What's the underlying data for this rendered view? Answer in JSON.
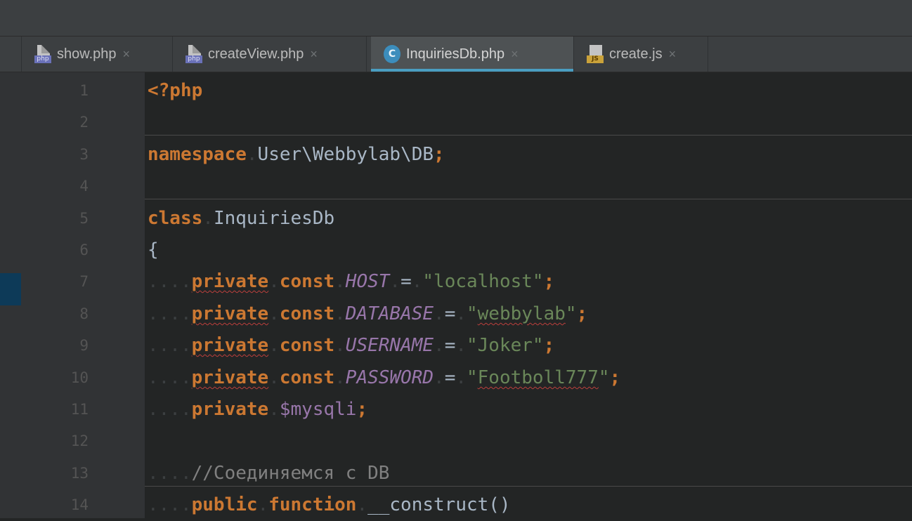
{
  "tabs": [
    {
      "label": "show.php",
      "icon": "php-file-icon",
      "badge": "php",
      "active": false
    },
    {
      "label": "createView.php",
      "icon": "php-file-icon",
      "badge": "php",
      "active": false
    },
    {
      "label": "InquiriesDb.php",
      "icon": "class-icon",
      "badge": "C",
      "active": true
    },
    {
      "label": "create.js",
      "icon": "js-file-icon",
      "badge": "JS",
      "active": false
    }
  ],
  "close_glyph": "×",
  "line_numbers": [
    "1",
    "2",
    "3",
    "4",
    "5",
    "6",
    "7",
    "8",
    "9",
    "10",
    "11",
    "12",
    "13",
    "14"
  ],
  "code": {
    "l1": {
      "tag": "<?php"
    },
    "l3": {
      "kw": "namespace",
      "ns": "User\\Webbylab\\DB",
      "semi": ";"
    },
    "l5": {
      "kw": "class",
      "name": "InquiriesDb"
    },
    "l6": {
      "brace": "{"
    },
    "l7": {
      "mod": "private",
      "kw": "const",
      "name": "HOST",
      "eq": "=",
      "val": "\"localhost\"",
      "semi": ";"
    },
    "l8": {
      "mod": "private",
      "kw": "const",
      "name": "DATABASE",
      "eq": "=",
      "q1": "\"",
      "val": "webbylab",
      "q2": "\"",
      "semi": ";"
    },
    "l9": {
      "mod": "private",
      "kw": "const",
      "name": "USERNAME",
      "eq": "=",
      "val": "\"Joker\"",
      "semi": ";"
    },
    "l10": {
      "mod": "private",
      "kw": "const",
      "name": "PASSWORD",
      "eq": "=",
      "q1": "\"",
      "val": "Footboll777",
      "q2": "\"",
      "semi": ";"
    },
    "l11": {
      "mod": "private",
      "var": "$mysqli",
      "semi": ";"
    },
    "l13": {
      "comment": "//Соединяемся c DB"
    },
    "l14": {
      "mod": "public",
      "kw": "function",
      "name": "__construct()"
    }
  },
  "colors": {
    "keyword": "#cc7832",
    "string": "#6a8759",
    "constant": "#9876aa",
    "comment": "#808080",
    "text": "#a9b7c6",
    "tab_accent": "#4a9ec1"
  }
}
